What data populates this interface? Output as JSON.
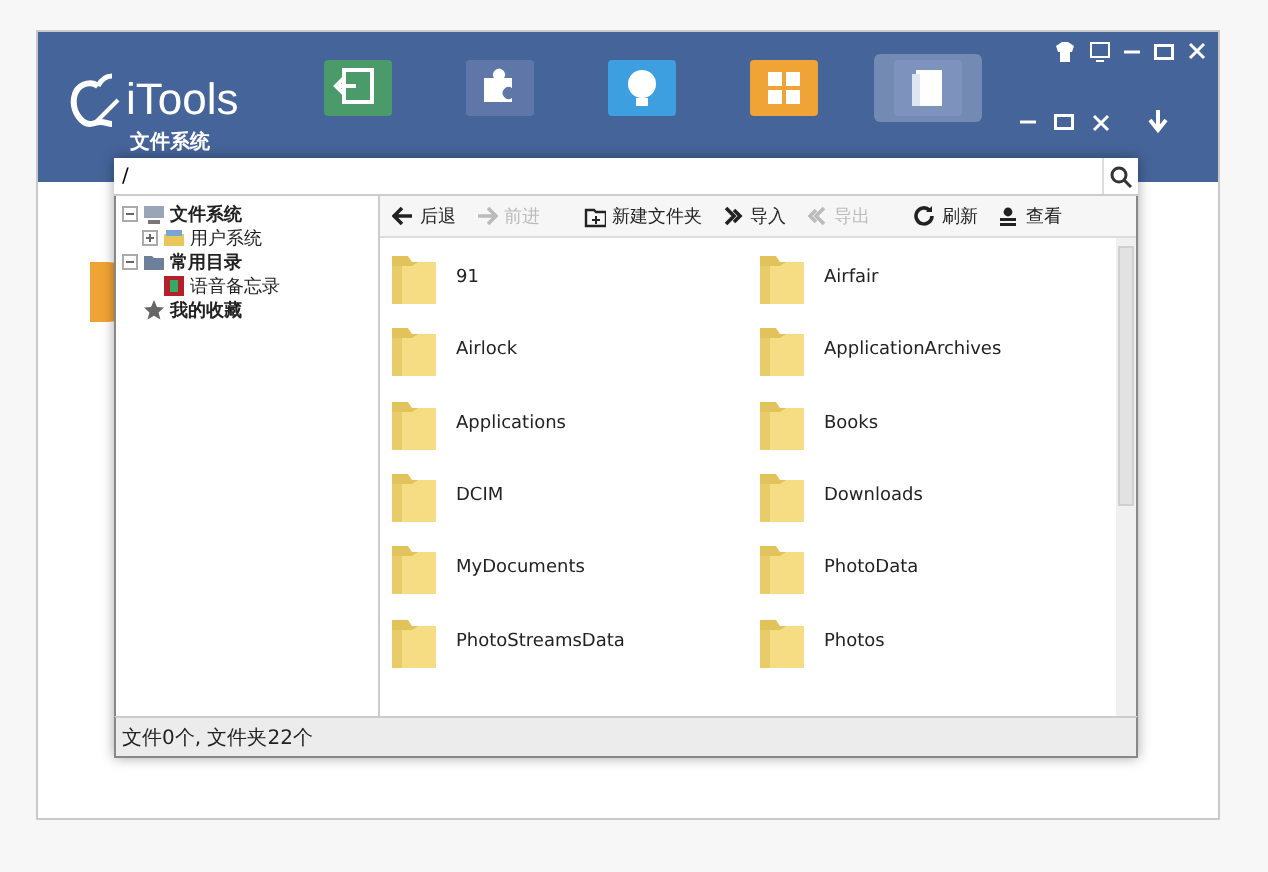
{
  "app": {
    "name": "iTools",
    "subtitle": "文件系统"
  },
  "tiles": [
    {
      "selected": false
    },
    {
      "selected": false
    },
    {
      "selected": false
    },
    {
      "selected": false
    },
    {
      "selected": true
    }
  ],
  "path_field": {
    "value": "/"
  },
  "tree": [
    {
      "label": "文件系统",
      "expanded": true,
      "children": [
        {
          "label": "用户系统",
          "expanded": false
        }
      ]
    },
    {
      "label": "常用目录",
      "expanded": true,
      "children": [
        {
          "label": "语音备忘录"
        }
      ]
    },
    {
      "label": "我的收藏"
    }
  ],
  "toolbar": [
    {
      "label": "后退",
      "disabled": false
    },
    {
      "label": "前进",
      "disabled": true
    },
    {
      "label": "新建文件夹",
      "disabled": false
    },
    {
      "label": "导入",
      "disabled": false
    },
    {
      "label": "导出",
      "disabled": true
    },
    {
      "label": "刷新",
      "disabled": false
    },
    {
      "label": "查看",
      "disabled": false
    }
  ],
  "folders": [
    {
      "name": "91"
    },
    {
      "name": "Airfair"
    },
    {
      "name": "Airlock"
    },
    {
      "name": "ApplicationArchives"
    },
    {
      "name": "Applications"
    },
    {
      "name": "Books"
    },
    {
      "name": "DCIM"
    },
    {
      "name": "Downloads"
    },
    {
      "name": "MyDocuments"
    },
    {
      "name": "PhotoData"
    },
    {
      "name": "PhotoStreamsData"
    },
    {
      "name": "Photos"
    }
  ],
  "status_bar": "文件0个, 文件夹22个"
}
